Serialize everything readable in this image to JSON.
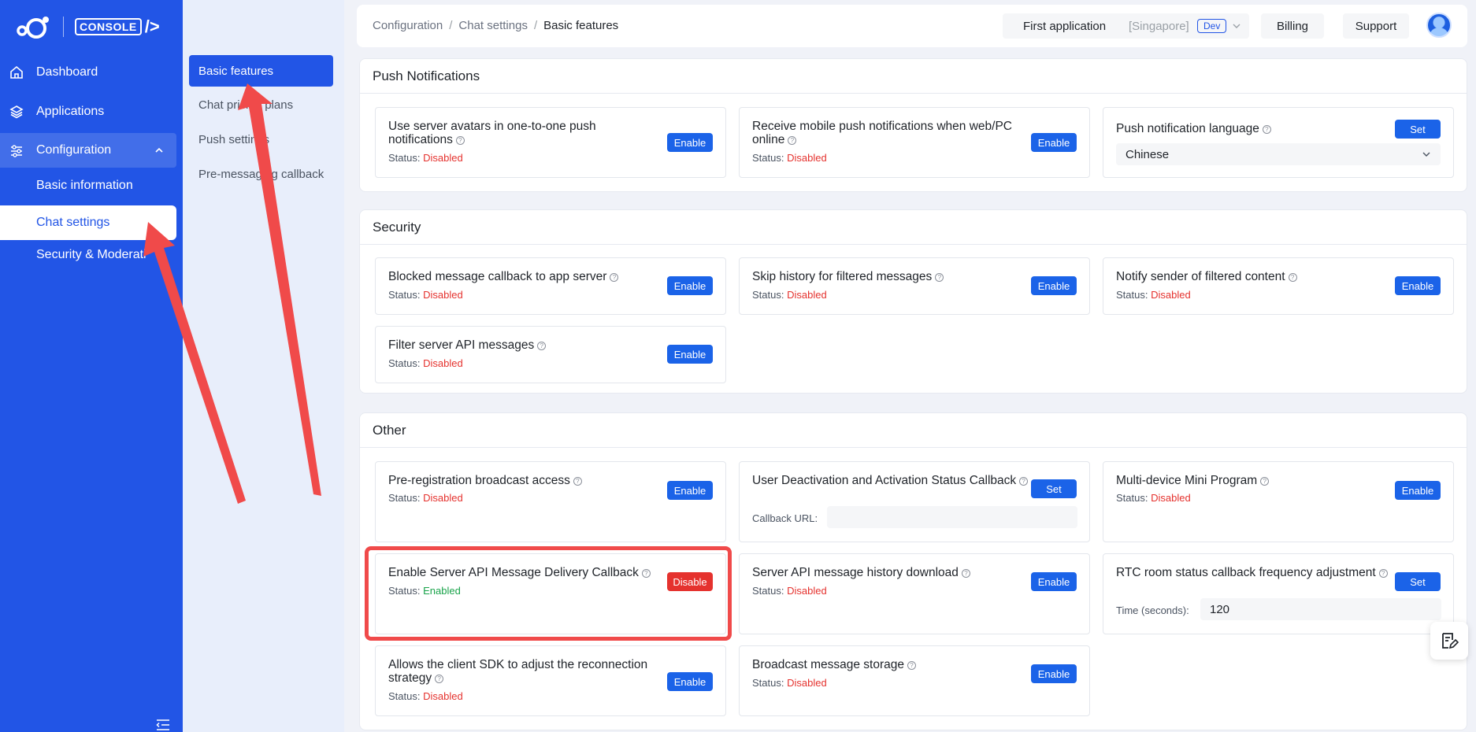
{
  "logo": {
    "console_label": "CONSOLE",
    "slash_label": "/>"
  },
  "sidebar": {
    "items": [
      {
        "label": "Dashboard",
        "icon": "home-icon"
      },
      {
        "label": "Applications",
        "icon": "layers-icon"
      },
      {
        "label": "Configuration",
        "icon": "sliders-icon",
        "expanded": true
      }
    ],
    "sub_items": [
      {
        "label": "Basic information"
      },
      {
        "label": "Chat settings",
        "active": true
      },
      {
        "label": "Security & Moderati"
      }
    ]
  },
  "subnav": {
    "items": [
      {
        "label": "Basic features",
        "active": true
      },
      {
        "label": "Chat pricing plans"
      },
      {
        "label": "Push settings"
      },
      {
        "label": "Pre-messaging callback"
      }
    ]
  },
  "topbar": {
    "breadcrumbs": [
      "Configuration",
      "Chat settings",
      "Basic features"
    ],
    "app_name": "First application",
    "region": "[Singapore]",
    "env": "Dev",
    "billing_label": "Billing",
    "support_label": "Support"
  },
  "labels": {
    "status": "Status:",
    "disabled": "Disabled",
    "enabled": "Enabled",
    "enable": "Enable",
    "disable": "Disable",
    "set": "Set"
  },
  "sections": {
    "push": {
      "title": "Push Notifications",
      "cards": [
        {
          "title": "Use server avatars in one-to-one push notifications"
        },
        {
          "title": "Receive mobile push notifications when web/PC online"
        },
        {
          "title": "Push notification language",
          "value": "Chinese"
        }
      ]
    },
    "security": {
      "title": "Security",
      "cards": [
        {
          "title": "Blocked message callback to app server"
        },
        {
          "title": "Skip history for filtered messages"
        },
        {
          "title": "Notify sender of filtered content"
        },
        {
          "title": "Filter server API messages"
        }
      ]
    },
    "other": {
      "title": "Other",
      "cards": [
        {
          "title": "Pre-registration broadcast access"
        },
        {
          "title": "User Deactivation and Activation Status Callback",
          "field_label": "Callback URL:",
          "field_value": ""
        },
        {
          "title": "Multi-device Mini Program"
        },
        {
          "title": "Enable Server API Message Delivery Callback"
        },
        {
          "title": "Server API message history download"
        },
        {
          "title": "RTC room status callback frequency adjustment",
          "field_label": "Time (seconds):",
          "field_value": "120"
        },
        {
          "title": "Allows the client SDK to adjust the reconnection strategy"
        },
        {
          "title": "Broadcast message storage"
        }
      ]
    }
  },
  "colors": {
    "primary": "#2255e6",
    "button": "#1b63e8",
    "danger": "#e5322e",
    "success": "#19a34a",
    "annotation": "#f04a4a"
  }
}
